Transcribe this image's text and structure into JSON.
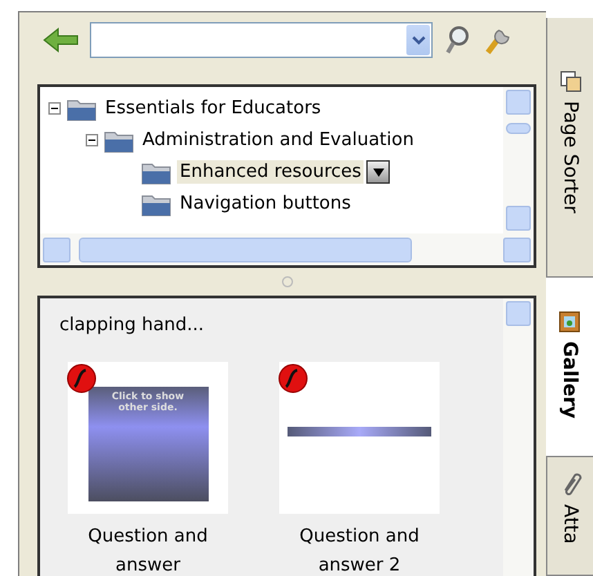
{
  "toolbar": {
    "buttons": [
      {
        "kind": "back"
      },
      {
        "kind": "search"
      },
      {
        "kind": "settings"
      }
    ]
  },
  "tree": {
    "items": [
      {
        "label": "Essentials for Educators",
        "expanded": true,
        "selected": false,
        "children": [
          {
            "label": "Administration and Evaluation",
            "expanded": true,
            "selected": false,
            "children": [
              {
                "label": "Enhanced resources",
                "selected": true
              },
              {
                "label": "Navigation buttons",
                "selected": false
              }
            ]
          }
        ]
      }
    ]
  },
  "gallery": {
    "cut_labels": [
      "clapping hand..."
    ],
    "items": [
      {
        "label": "Question and answer",
        "kind": "card",
        "thumbnail_text": "Click to show other side."
      },
      {
        "label": "Question and answer 2",
        "kind": "bar"
      }
    ]
  },
  "tabs": [
    {
      "label": "Page Sorter",
      "kind": "sorter",
      "selected": false
    },
    {
      "label": "Gallery",
      "kind": "gallery",
      "selected": true
    },
    {
      "label": "Atta",
      "kind": "clip",
      "selected": false
    }
  ]
}
